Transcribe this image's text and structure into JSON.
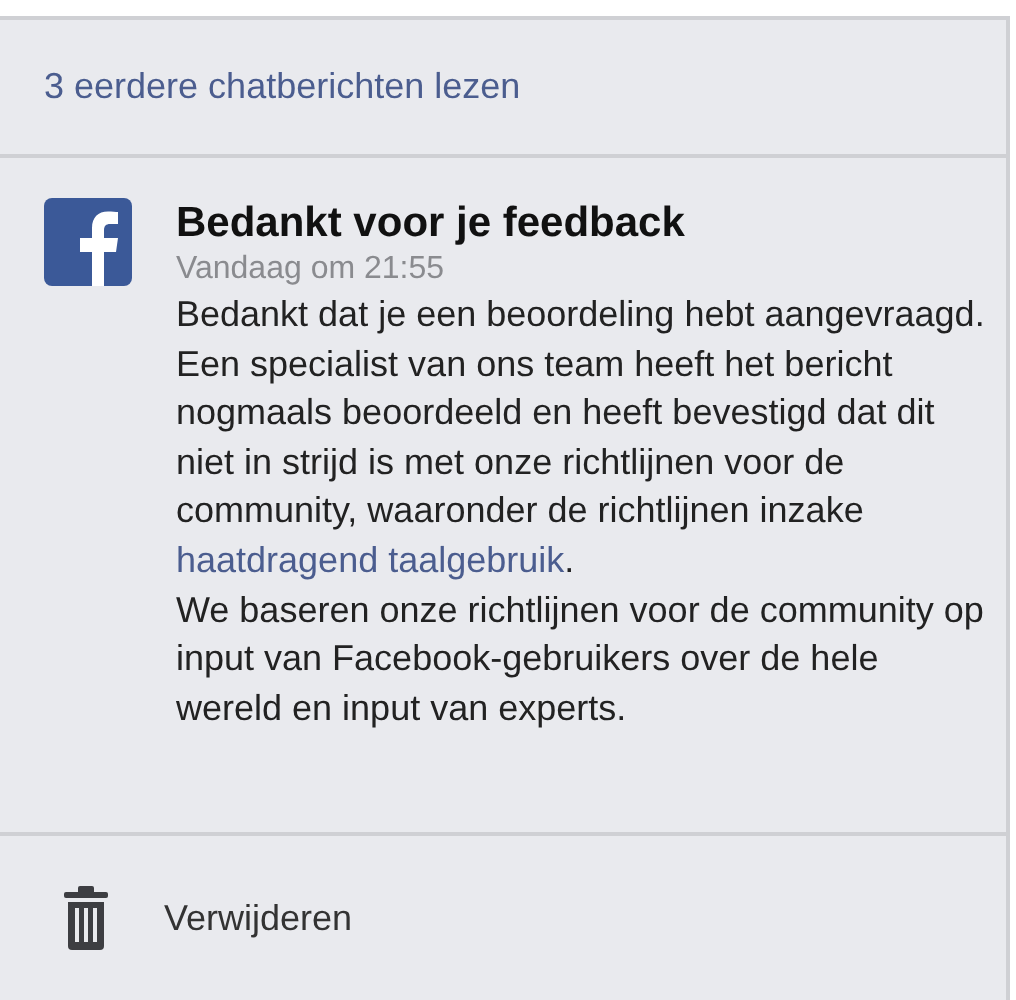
{
  "earlier_messages_link": "3 eerdere chatberichten lezen",
  "message": {
    "title": "Bedankt voor je feedback",
    "timestamp": "Vandaag om 21:55",
    "paragraphs": [
      {
        "text": "Bedankt dat je een beoordeling hebt aangevraagd."
      },
      {
        "text": "Een specialist van ons team heeft het bericht nogmaals beoordeeld en heeft bevestigd dat dit niet in strijd is met onze richtlijnen voor de community, waaronder de richtlijnen inzake ",
        "link": "haatdragend taalgebruik",
        "text_after": "."
      },
      {
        "text": "We baseren onze richtlijnen voor de community op input van Facebook-gebruikers over de hele wereld en input van experts."
      }
    ]
  },
  "delete_action": {
    "label": "Verwijderen"
  }
}
